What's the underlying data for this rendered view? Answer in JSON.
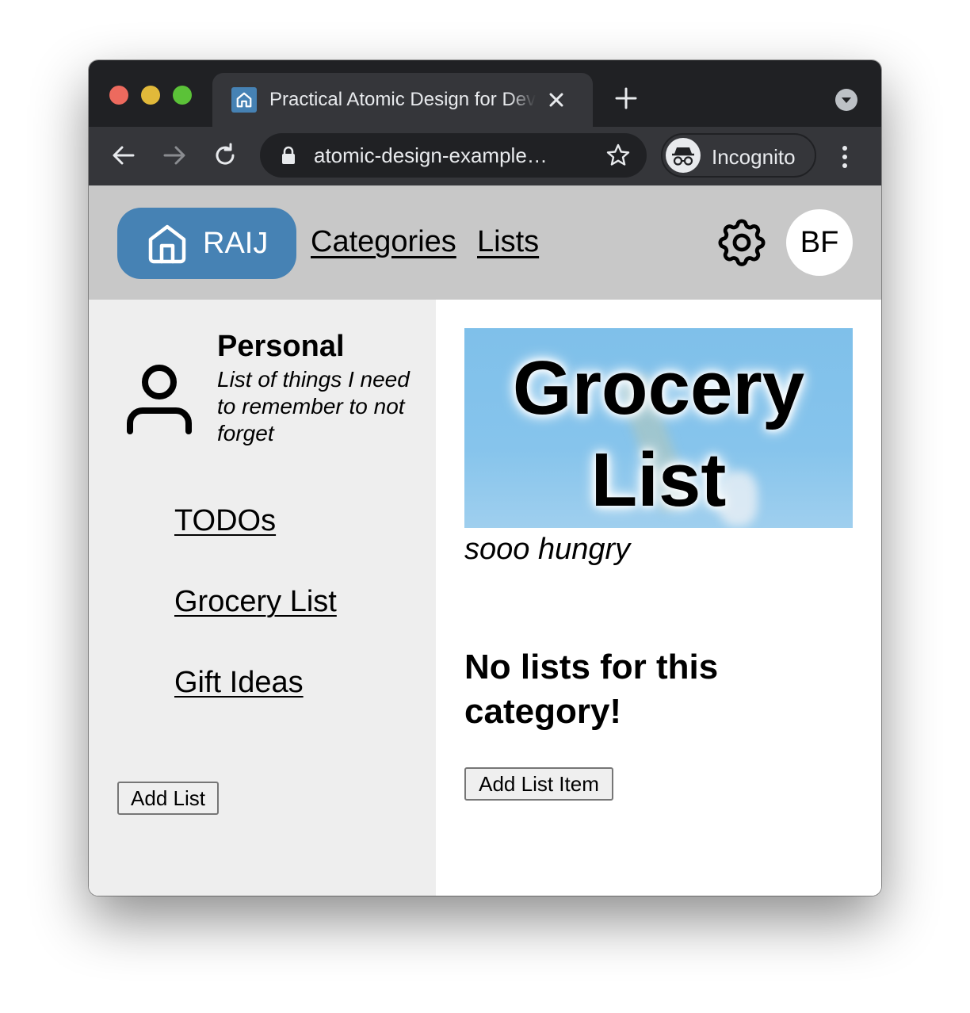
{
  "browser": {
    "tab_title": "Practical Atomic Design for Developers",
    "url": "atomic-design-example…",
    "incognito_label": "Incognito"
  },
  "header": {
    "home_label": "RAIJ",
    "nav": [
      "Categories",
      "Lists"
    ],
    "avatar_initials": "BF"
  },
  "sidebar": {
    "category_title": "Personal",
    "category_description": "List of things I need to remember to not forget",
    "lists": [
      "TODOs",
      "Grocery List",
      "Gift Ideas"
    ],
    "add_list_label": "Add List"
  },
  "main": {
    "banner_title": "Grocery List",
    "subtitle": "sooo hungry",
    "empty_message": "No lists for this category!",
    "add_item_label": "Add List Item"
  },
  "colors": {
    "brand": "#4682b4",
    "header_bg": "#c8c8c8",
    "sidebar_bg": "#eeeeee"
  }
}
